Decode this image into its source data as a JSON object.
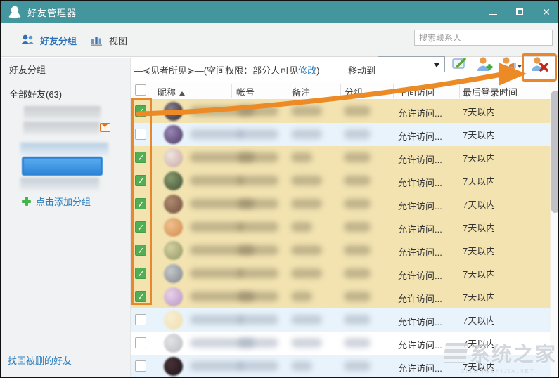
{
  "window": {
    "title": "好友管理器",
    "controls": {
      "minimize": "minimize",
      "maximize": "maximize",
      "close": "✕"
    }
  },
  "toolbar": {
    "tabs": [
      {
        "label": "好友分组",
        "icon": "friends-group-icon",
        "active": true
      },
      {
        "label": "视图",
        "icon": "chart-view-icon",
        "active": false
      }
    ],
    "search_placeholder": "搜索联系人"
  },
  "sidebar": {
    "header": "好友分组",
    "all_friends": "全部好友(63)",
    "groups": [
      {
        "redacted": true,
        "style": "gray",
        "has_mail": false
      },
      {
        "redacted": true,
        "style": "gray",
        "has_mail": true
      },
      {
        "redacted": true,
        "style": "bluetint",
        "has_mail": false
      },
      {
        "redacted": true,
        "style": "selected",
        "has_mail": false
      },
      {
        "redacted": true,
        "style": "bluegray",
        "has_mail": false
      }
    ],
    "add_group_label": "点击添加分组",
    "recover_link": "找回被删的好友"
  },
  "content_header": {
    "group_title_prefix": "—≼见者所见≽—(空间权限：部分人可见",
    "modify_link": "修改",
    "group_title_suffix": ")",
    "move_to_label": "移动到",
    "move_to_value": "",
    "actions": [
      "rename-group",
      "add-friend",
      "recommend-friend",
      "delete-friend"
    ]
  },
  "table": {
    "columns": [
      "昵称",
      "帐号",
      "备注",
      "分组",
      "空间访问",
      "最后登录时间"
    ],
    "sort_column": "昵称",
    "sort_order": "asc",
    "access_text": "允许访问...",
    "login_text": "7天以内",
    "rows": [
      {
        "checked": true,
        "bg": "tan",
        "avatar": [
          "#8a7f8f",
          "#2e2a33"
        ]
      },
      {
        "checked": false,
        "bg": "blue",
        "avatar": [
          "#9a86b8",
          "#4a3a5e"
        ]
      },
      {
        "checked": true,
        "bg": "tan",
        "avatar": [
          "#efe4e0",
          "#c9a8a0"
        ]
      },
      {
        "checked": true,
        "bg": "tan",
        "avatar": [
          "#879a6d",
          "#3f4f33"
        ]
      },
      {
        "checked": true,
        "bg": "tan",
        "avatar": [
          "#b08a6e",
          "#6e4f3f"
        ]
      },
      {
        "checked": true,
        "bg": "tan",
        "avatar": [
          "#f0c090",
          "#d08a4a"
        ]
      },
      {
        "checked": true,
        "bg": "tan",
        "avatar": [
          "#d4cfa0",
          "#8f9663"
        ]
      },
      {
        "checked": true,
        "bg": "tan",
        "avatar": [
          "#c4c8cc",
          "#7f8488"
        ]
      },
      {
        "checked": true,
        "bg": "tan",
        "avatar": [
          "#e8d2ec",
          "#b793c0"
        ]
      },
      {
        "checked": false,
        "bg": "blue",
        "avatar": [
          "#f7efd3",
          "#f0dcaa"
        ]
      },
      {
        "checked": false,
        "bg": "white",
        "avatar": [
          "#e2e3e5",
          "#b9bdc2"
        ]
      },
      {
        "checked": false,
        "bg": "blue",
        "avatar": [
          "#4a3136",
          "#17141a"
        ]
      }
    ]
  },
  "annotations": {
    "highlight_color": "#e8872b"
  },
  "watermark": {
    "text": "系统之家",
    "subtext": "XITONGZHIJIA.NET"
  },
  "colors": {
    "titlebar": "#43969e",
    "selected_row": "#f2e3b1",
    "alt_row": "#e9f3fb",
    "checked_green": "#52ae52",
    "link_blue": "#2d7dbd",
    "selected_group": "#2e82d4"
  }
}
